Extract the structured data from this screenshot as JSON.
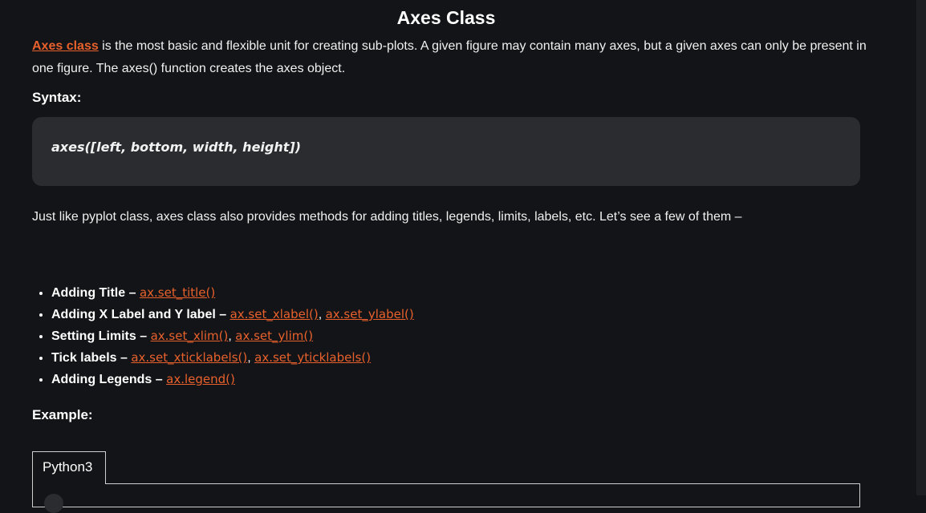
{
  "article": {
    "title": "Axes Class",
    "intro_link": "Axes class",
    "intro_text": " is the most basic and flexible unit for creating sub-plots. A given figure may contain many axes, but a given axes can only be present in one figure. The axes() function creates the axes object.",
    "syntax_label": "Syntax:",
    "syntax_code": "axes([left, bottom, width, height])",
    "description": "Just like pyplot class, axes class also provides methods for adding titles, legends, limits, labels, etc. Let’s see a few of them –",
    "methods": [
      {
        "label": "Adding Title – ",
        "links": [
          "ax.set_title()"
        ]
      },
      {
        "label": "Adding X Label and Y label – ",
        "links": [
          "ax.set_xlabel()",
          "ax.set_ylabel()"
        ]
      },
      {
        "label": "Setting Limits – ",
        "links": [
          "ax.set_xlim()",
          "ax.set_ylim()"
        ]
      },
      {
        "label": "Tick labels – ",
        "links": [
          "ax.set_xticklabels()",
          "ax.set_yticklabels()"
        ]
      },
      {
        "label": "Adding Legends – ",
        "links": [
          "ax.legend()"
        ]
      }
    ],
    "link_separator": ", ",
    "example_label": "Example:",
    "code_tab": "Python3"
  },
  "colors": {
    "background": "#131417",
    "link": "#e8612c",
    "code_background": "#2b2c30"
  }
}
